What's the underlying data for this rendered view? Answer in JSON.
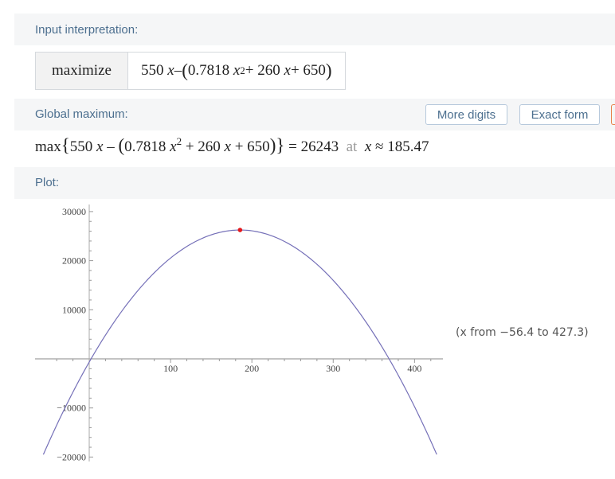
{
  "input_interpretation": {
    "title": "Input interpretation:",
    "operation": "maximize",
    "expression": {
      "lead": "550",
      "var": "x",
      "minus": " – ",
      "coef": "0.7818",
      "exponent": "2",
      "rest": " + 260",
      "tail": " + 650"
    }
  },
  "global_maximum": {
    "title": "Global maximum:",
    "buttons": {
      "more_digits": "More digits",
      "exact_form": "Exact form"
    },
    "result": {
      "func": "max",
      "value": "26243",
      "at": "at",
      "approx": "≈",
      "x_value": "185.47"
    }
  },
  "plot": {
    "title": "Plot:",
    "range_note": "(x from −56.4 to 427.3)"
  },
  "colors": {
    "curve": "#7570b8",
    "max_point": "#e41a1c",
    "pod_title": "#4c6f8f"
  },
  "chart_data": {
    "type": "line",
    "title": "",
    "xlabel": "",
    "ylabel": "",
    "function": "550x - (0.7818x^2 + 260x + 650)",
    "xlim": [
      -56.4,
      427.3
    ],
    "ylim": [
      -20000,
      30000
    ],
    "x_ticks": [
      100,
      200,
      300,
      400
    ],
    "y_ticks": [
      -20000,
      -10000,
      10000,
      20000,
      30000
    ],
    "x_tick_labels": [
      "100",
      "200",
      "300",
      "400"
    ],
    "y_tick_labels": [
      "−10000",
      "−20000",
      "10000",
      "20000",
      "30000"
    ],
    "series": [
      {
        "x": [
          -56.4,
          0,
          50,
          100,
          150,
          185.47,
          200,
          250,
          300,
          350,
          427.3
        ],
        "y": [
          -19494,
          -650,
          11896,
          20532,
          25259,
          26243,
          26077,
          23986,
          18985,
          11076,
          -19353
        ]
      }
    ],
    "marker": {
      "x": 185.47,
      "y": 26243
    },
    "grid": false,
    "legend": "none"
  }
}
